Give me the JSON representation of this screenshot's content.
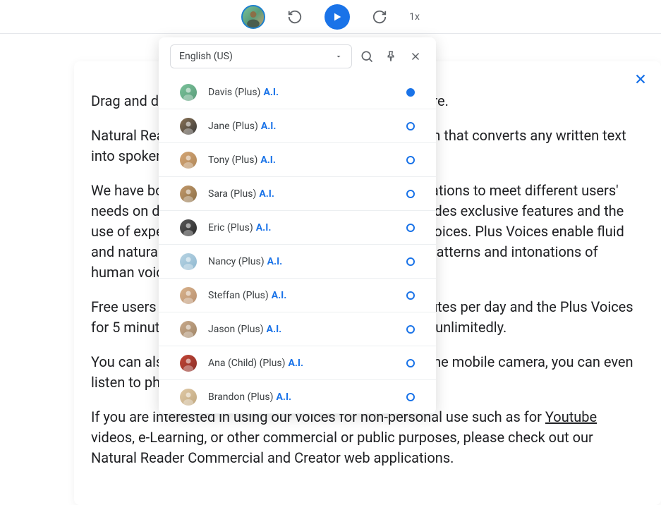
{
  "topbar": {
    "speed_label": "1x"
  },
  "card": {
    "p1": "Drag and drop your files, or type, paste, and edit text here.",
    "p2": "Natural Reader is a professional text-to-speech program that converts any written text into spoken words.",
    "p3_a": "We have both free and paid subscriptions to our applications to meet different users' needs on different budgets. Our Plus subscription includes exclusive features and the use of expertly engineered Plus Voices, our advanced voices. Plus Voices enable fluid and natural-sounding text to speech that matches the patterns and intonations of human voices.",
    "p4": "Free users can sample the Premium Voices for 20 minutes per day and the Plus Voices for 5 minutes per day. Or use any available Free Voices unlimitedly.",
    "p5": "You can also listen and go with our mobile app. Using the mobile camera, you can even listen to physical books and printed text and notes.",
    "p6_a": "If you are interested in using our voices for non-personal use such as for ",
    "p6_b": "Youtube",
    "p6_c": " videos, e-Learning, or other commercial or public purposes, please check out our Natural Reader Commercial and Creator web applications."
  },
  "voice_panel": {
    "language": "English (US)",
    "voices": [
      {
        "name": "Davis (Plus)",
        "tag": "A.I.",
        "selected": true,
        "avatar_bg": "linear-gradient(135deg,#7ac29a,#5a9c7a)"
      },
      {
        "name": "Jane (Plus)",
        "tag": "A.I.",
        "selected": false,
        "avatar_bg": "linear-gradient(135deg,#8b7355,#3a3a3a)"
      },
      {
        "name": "Tony (Plus)",
        "tag": "A.I.",
        "selected": false,
        "avatar_bg": "linear-gradient(135deg,#d4a574,#b0885a)"
      },
      {
        "name": "Sara (Plus)",
        "tag": "A.I.",
        "selected": false,
        "avatar_bg": "linear-gradient(135deg,#c49a6c,#8b6f47)"
      },
      {
        "name": "Eric (Plus)",
        "tag": "A.I.",
        "selected": false,
        "avatar_bg": "linear-gradient(135deg,#5a5a5a,#2a2a2a)"
      },
      {
        "name": "Nancy (Plus)",
        "tag": "A.I.",
        "selected": false,
        "avatar_bg": "linear-gradient(135deg,#b8d4e3,#8fb8d0)"
      },
      {
        "name": "Steffan (Plus)",
        "tag": "A.I.",
        "selected": false,
        "avatar_bg": "linear-gradient(135deg,#d9b38c,#b89070)"
      },
      {
        "name": "Jason (Plus)",
        "tag": "A.I.",
        "selected": false,
        "avatar_bg": "linear-gradient(135deg,#c9a98a,#a08668)"
      },
      {
        "name": "Ana (Child) (Plus)",
        "tag": "A.I.",
        "selected": false,
        "avatar_bg": "linear-gradient(135deg,#c44536,#8a3028)"
      },
      {
        "name": "Brandon (Plus)",
        "tag": "A.I.",
        "selected": false,
        "avatar_bg": "linear-gradient(135deg,#e0c9a6,#c0a880)"
      }
    ]
  }
}
